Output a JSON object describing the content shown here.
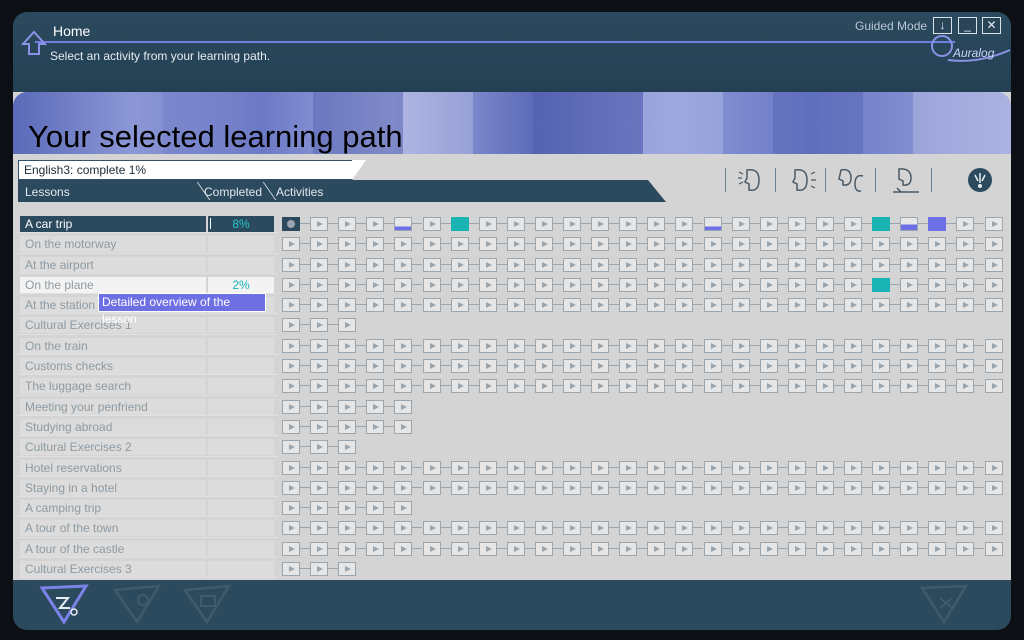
{
  "header": {
    "title": "Home",
    "subtitle": "Select an activity from your learning path.",
    "guided_mode": "Guided Mode",
    "btn_guide": "↓",
    "btn_min": "_",
    "btn_close": "✕",
    "logo": "Auralog"
  },
  "banner": {
    "title": "Your selected learning path"
  },
  "path": {
    "field": "English3: complete 1%",
    "col_lessons": "Lessons",
    "col_completed": "Completed",
    "col_activities": "Activities"
  },
  "tooltip": "Detailed overview of the lesson",
  "lessons": [
    {
      "name": "A car trip",
      "completed": "8%",
      "state": "selected",
      "activities": 26
    },
    {
      "name": "On the motorway",
      "completed": "",
      "state": "",
      "activities": 26
    },
    {
      "name": "At the airport",
      "completed": "",
      "state": "",
      "activities": 26
    },
    {
      "name": "On the plane",
      "completed": "2%",
      "state": "light",
      "activities": 26
    },
    {
      "name": "At the station",
      "completed": "",
      "state": "",
      "activities": 26
    },
    {
      "name": "Cultural Exercises 1",
      "completed": "",
      "state": "",
      "activities": 3
    },
    {
      "name": "On the train",
      "completed": "",
      "state": "",
      "activities": 26
    },
    {
      "name": "Customs checks",
      "completed": "",
      "state": "",
      "activities": 26
    },
    {
      "name": "The luggage search",
      "completed": "",
      "state": "",
      "activities": 26
    },
    {
      "name": "Meeting your penfriend",
      "completed": "",
      "state": "",
      "activities": 5
    },
    {
      "name": "Studying abroad",
      "completed": "",
      "state": "",
      "activities": 5
    },
    {
      "name": "Cultural Exercises 2",
      "completed": "",
      "state": "",
      "activities": 3
    },
    {
      "name": "Hotel reservations",
      "completed": "",
      "state": "",
      "activities": 26
    },
    {
      "name": "Staying in a hotel",
      "completed": "",
      "state": "",
      "activities": 26
    },
    {
      "name": "A camping trip",
      "completed": "",
      "state": "",
      "activities": 5
    },
    {
      "name": "A tour of the town",
      "completed": "",
      "state": "",
      "activities": 26
    },
    {
      "name": "A tour of the castle",
      "completed": "",
      "state": "",
      "activities": 26
    },
    {
      "name": "Cultural Exercises 3",
      "completed": "",
      "state": "",
      "activities": 3
    }
  ],
  "activity_status": {
    "0": {
      "0": "current",
      "4": "partial-low",
      "6": "teal",
      "15": "partial-low",
      "21": "teal",
      "22": "partial",
      "23": "blue"
    },
    "3": {
      "21": "teal"
    }
  },
  "icons": {
    "home": "home-arrow-icon",
    "modes": [
      "listen-icon",
      "speak-icon",
      "dialogue-icon",
      "write-icon",
      "lightbulb-icon"
    ],
    "footer": [
      "path-icon",
      "settings-icon",
      "book-icon",
      "exit-icon"
    ]
  },
  "colors": {
    "header": "#2c4a5e",
    "accent_blue": "#6c6fe6",
    "accent_teal": "#19b3b3",
    "panel": "#d4d4d4"
  }
}
